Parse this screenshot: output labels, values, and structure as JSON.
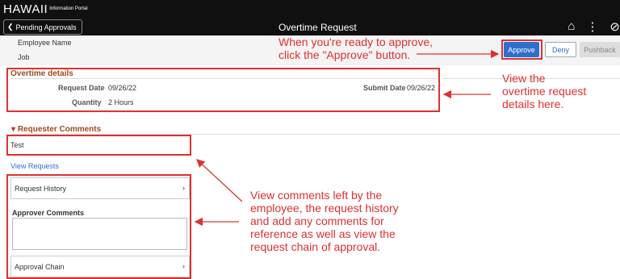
{
  "app": {
    "logo_main": "HAWAII",
    "logo_sub": "Information Portal",
    "back_label": "Pending Approvals",
    "page_title": "Overtime Request",
    "icons": [
      "home-icon",
      "more-icon",
      "cancel-icon"
    ]
  },
  "header": {
    "employee_label": "Employee Name",
    "job_label": "Job",
    "approve": "Approve",
    "deny": "Deny",
    "pushback": "Pushback"
  },
  "overtime": {
    "section_title": "Overtime details",
    "request_date_label": "Request Date",
    "request_date": "09/26/22",
    "quantity_label": "Quantity",
    "quantity": "2 Hours",
    "submit_date_label": "Submit Date",
    "submit_date": "09/26/22"
  },
  "comments": {
    "section_title": "Requester Comments",
    "text": "Test",
    "view_requests": "View Requests",
    "request_history": "Request History",
    "approver_comments": "Approver Comments",
    "approval_chain": "Approval Chain"
  },
  "annotations": {
    "approve_note": [
      "When you're ready to approve,",
      "click the \"Approve\" button."
    ],
    "details_note": [
      "View the",
      "overtime request",
      "details here."
    ],
    "comments_note": [
      "View comments left by the",
      "employee, the request history",
      "and add any comments for",
      "reference as well as view the",
      "request chain of approval."
    ]
  },
  "colors": {
    "accent": "#2f6fcc",
    "annotation": "#e03030",
    "section_title": "#a34a1a"
  }
}
